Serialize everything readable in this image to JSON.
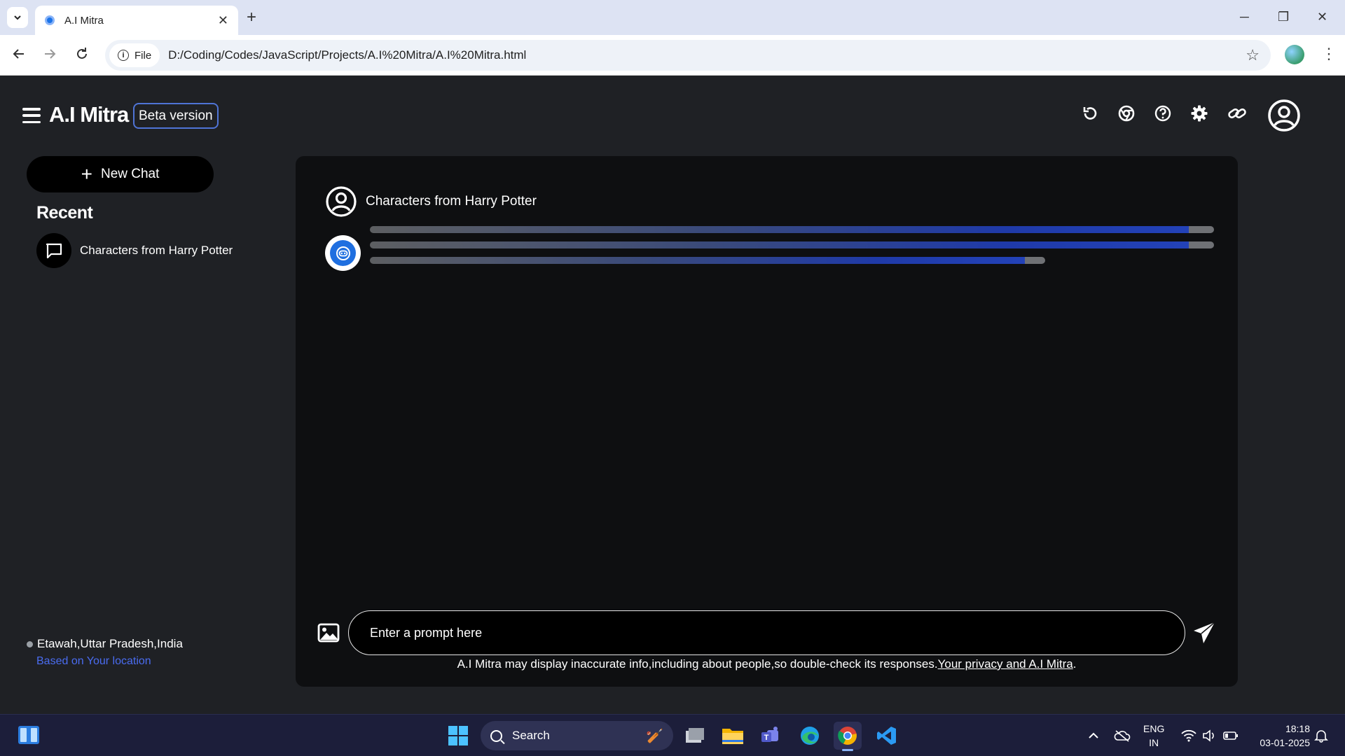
{
  "browser": {
    "tab_title": "A.I Mitra",
    "new_tab": "+",
    "url_chip": "File",
    "url": "D:/Coding/Codes/JavaScript/Projects/A.I%20Mitra/A.I%20Mitra.html",
    "window_controls": {
      "minimize": "─",
      "restore": "❐",
      "close": "✕"
    }
  },
  "app": {
    "brand": "A.I Mitra",
    "badge": "Beta version",
    "top_icons": [
      "reset-icon",
      "chrome-icon",
      "help-icon",
      "settings-icon",
      "link-icon",
      "user-avatar-icon"
    ],
    "sidebar": {
      "new_chat": "New Chat",
      "recent_heading": "Recent",
      "recent_items": [
        {
          "label": "Characters from Harry Potter"
        }
      ],
      "location": "Etawah,Uttar Pradesh,India",
      "location_link": "Based on Your location"
    },
    "chat": {
      "user_message": "Characters from Harry Potter",
      "loading_bars": [
        1.0,
        1.0,
        0.8
      ]
    },
    "input": {
      "placeholder": "Enter a prompt here"
    },
    "disclaimer": {
      "text": "A.I Mitra may display inaccurate info,including about people,so double-check its responses.",
      "link": "Your privacy and A.I Mitra",
      "suffix": "."
    }
  },
  "taskbar": {
    "search": "Search",
    "language": {
      "line1": "ENG",
      "line2": "IN"
    },
    "time": "18:18",
    "date": "03-01-2025",
    "colors": {
      "background": "#1c1e3a",
      "accent": "#8ab4f8"
    }
  }
}
